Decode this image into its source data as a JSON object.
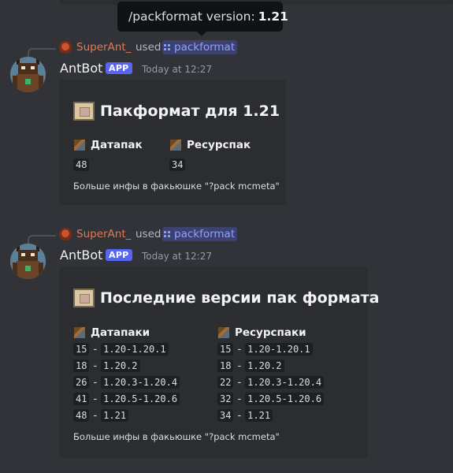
{
  "tooltip": {
    "prefix": "/packformat version:",
    "value": "1.21"
  },
  "messages": [
    {
      "reply": {
        "user": "SuperAnt_",
        "used": "used",
        "command": "packformat"
      },
      "author": {
        "name": "AntBot",
        "badge": "APP",
        "timestamp": "Today at 12:27"
      },
      "embed": {
        "title": "Пакформат для 1.21",
        "fields": [
          {
            "name": "Датапак",
            "value": "48"
          },
          {
            "name": "Ресурспак",
            "value": "34"
          }
        ],
        "footer": "Больше инфы в факьюшке \"?pack mcmeta\""
      }
    },
    {
      "reply": {
        "user": "SuperAnt_",
        "used": "used",
        "command": "packformat"
      },
      "author": {
        "name": "AntBot",
        "badge": "APP",
        "timestamp": "Today at 12:27"
      },
      "embed": {
        "title": "Последние версии пак формата",
        "columns": [
          {
            "name": "Датапаки",
            "rows": [
              {
                "num": "15",
                "range": "1.20-1.20.1"
              },
              {
                "num": "18",
                "range": "1.20.2"
              },
              {
                "num": "26",
                "range": "1.20.3-1.20.4"
              },
              {
                "num": "41",
                "range": "1.20.5-1.20.6"
              },
              {
                "num": "48",
                "range": "1.21"
              }
            ]
          },
          {
            "name": "Ресурспаки",
            "rows": [
              {
                "num": "15",
                "range": "1.20-1.20.1"
              },
              {
                "num": "18",
                "range": "1.20.2"
              },
              {
                "num": "22",
                "range": "1.20.3-1.20.4"
              },
              {
                "num": "32",
                "range": "1.20.5-1.20.6"
              },
              {
                "num": "34",
                "range": "1.21"
              }
            ]
          }
        ],
        "dash": "-",
        "footer": "Больше инфы в факьюшке \"?pack mcmeta\""
      }
    }
  ],
  "icons": {
    "avatar": "ant-robot-avatar-icon",
    "mini_avatar": "ant-mini-avatar-icon",
    "command": "slash-command-icon",
    "scroll": "scroll-icon",
    "block": "grass-block-icon"
  },
  "colors": {
    "background": "#313338",
    "embed": "#2b2d31",
    "accent": "#5865f2",
    "reply_user": "#e07a54",
    "command_text": "#8ea1ff"
  }
}
